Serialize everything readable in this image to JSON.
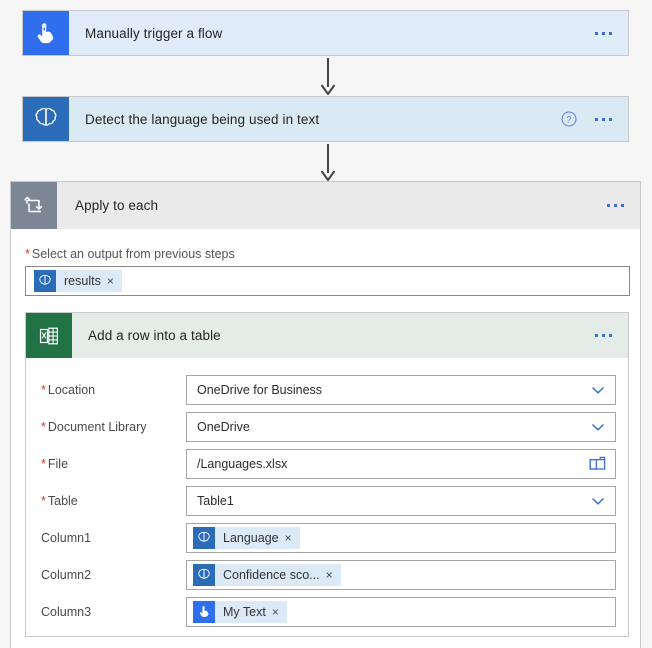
{
  "flow": {
    "trigger": {
      "title": "Manually trigger a flow",
      "icon": "tap-hand-icon",
      "accent": "#2f6fed",
      "card_bg": "#e1ecfb",
      "menu": "more-options"
    },
    "detect": {
      "title": "Detect the language being used in text",
      "icon": "brain-icon",
      "accent": "#2b6cb8",
      "card_bg": "#daeaf5",
      "help": "?",
      "menu": "more-options"
    },
    "foreach": {
      "title": "Apply to each",
      "icon": "loop-icon",
      "accent": "#7b8794",
      "header_bg": "#eaeaea",
      "output_label": "Select an output from previous steps",
      "required_marker": "*",
      "output_token": {
        "text": "results",
        "icon": "brain-icon",
        "remove": "×"
      },
      "menu": "more-options"
    },
    "excel": {
      "title": "Add a row into a table",
      "icon": "excel-icon",
      "accent": "#217346",
      "header_bg": "#e3ece6",
      "menu": "more-options",
      "fields": [
        {
          "label": "Location",
          "required": true,
          "type": "dropdown",
          "value": "OneDrive for Business",
          "name": "location"
        },
        {
          "label": "Document Library",
          "required": true,
          "type": "dropdown",
          "value": "OneDrive",
          "name": "document-library"
        },
        {
          "label": "File",
          "required": true,
          "type": "filepicker",
          "value": "/Languages.xlsx",
          "name": "file"
        },
        {
          "label": "Table",
          "required": true,
          "type": "dropdown",
          "value": "Table1",
          "name": "table"
        },
        {
          "label": "Column1",
          "required": false,
          "type": "token",
          "token_text": "Language",
          "token_icon": "brain-icon",
          "token_remove": "×",
          "name": "column1"
        },
        {
          "label": "Column2",
          "required": false,
          "type": "token",
          "token_text": "Confidence sco...",
          "token_icon": "brain-icon",
          "token_remove": "×",
          "name": "column2"
        },
        {
          "label": "Column3",
          "required": false,
          "type": "token",
          "token_text": "My Text",
          "token_icon": "tap-hand-icon",
          "token_remove": "×",
          "name": "column3"
        }
      ]
    }
  }
}
